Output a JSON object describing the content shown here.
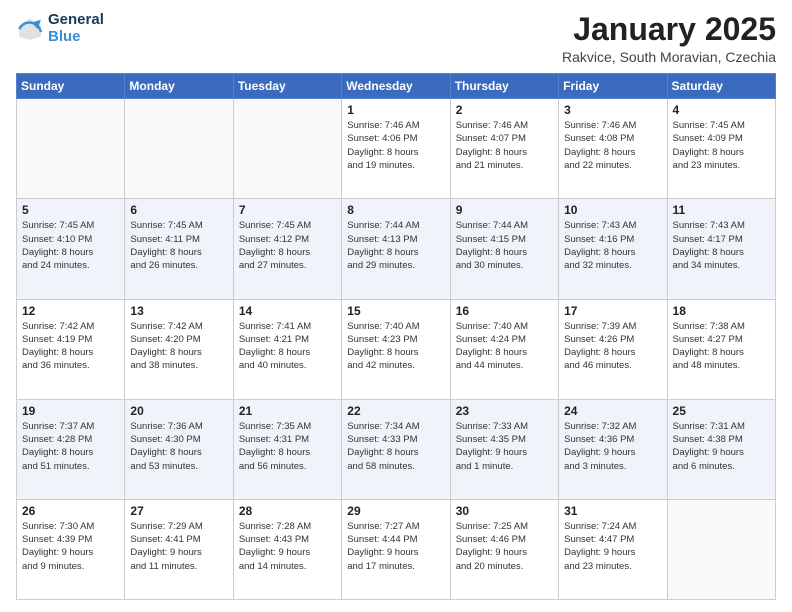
{
  "logo": {
    "line1": "General",
    "line2": "Blue"
  },
  "title": "January 2025",
  "location": "Rakvice, South Moravian, Czechia",
  "days_header": [
    "Sunday",
    "Monday",
    "Tuesday",
    "Wednesday",
    "Thursday",
    "Friday",
    "Saturday"
  ],
  "weeks": [
    [
      {
        "day": "",
        "info": ""
      },
      {
        "day": "",
        "info": ""
      },
      {
        "day": "",
        "info": ""
      },
      {
        "day": "1",
        "info": "Sunrise: 7:46 AM\nSunset: 4:06 PM\nDaylight: 8 hours\nand 19 minutes."
      },
      {
        "day": "2",
        "info": "Sunrise: 7:46 AM\nSunset: 4:07 PM\nDaylight: 8 hours\nand 21 minutes."
      },
      {
        "day": "3",
        "info": "Sunrise: 7:46 AM\nSunset: 4:08 PM\nDaylight: 8 hours\nand 22 minutes."
      },
      {
        "day": "4",
        "info": "Sunrise: 7:45 AM\nSunset: 4:09 PM\nDaylight: 8 hours\nand 23 minutes."
      }
    ],
    [
      {
        "day": "5",
        "info": "Sunrise: 7:45 AM\nSunset: 4:10 PM\nDaylight: 8 hours\nand 24 minutes."
      },
      {
        "day": "6",
        "info": "Sunrise: 7:45 AM\nSunset: 4:11 PM\nDaylight: 8 hours\nand 26 minutes."
      },
      {
        "day": "7",
        "info": "Sunrise: 7:45 AM\nSunset: 4:12 PM\nDaylight: 8 hours\nand 27 minutes."
      },
      {
        "day": "8",
        "info": "Sunrise: 7:44 AM\nSunset: 4:13 PM\nDaylight: 8 hours\nand 29 minutes."
      },
      {
        "day": "9",
        "info": "Sunrise: 7:44 AM\nSunset: 4:15 PM\nDaylight: 8 hours\nand 30 minutes."
      },
      {
        "day": "10",
        "info": "Sunrise: 7:43 AM\nSunset: 4:16 PM\nDaylight: 8 hours\nand 32 minutes."
      },
      {
        "day": "11",
        "info": "Sunrise: 7:43 AM\nSunset: 4:17 PM\nDaylight: 8 hours\nand 34 minutes."
      }
    ],
    [
      {
        "day": "12",
        "info": "Sunrise: 7:42 AM\nSunset: 4:19 PM\nDaylight: 8 hours\nand 36 minutes."
      },
      {
        "day": "13",
        "info": "Sunrise: 7:42 AM\nSunset: 4:20 PM\nDaylight: 8 hours\nand 38 minutes."
      },
      {
        "day": "14",
        "info": "Sunrise: 7:41 AM\nSunset: 4:21 PM\nDaylight: 8 hours\nand 40 minutes."
      },
      {
        "day": "15",
        "info": "Sunrise: 7:40 AM\nSunset: 4:23 PM\nDaylight: 8 hours\nand 42 minutes."
      },
      {
        "day": "16",
        "info": "Sunrise: 7:40 AM\nSunset: 4:24 PM\nDaylight: 8 hours\nand 44 minutes."
      },
      {
        "day": "17",
        "info": "Sunrise: 7:39 AM\nSunset: 4:26 PM\nDaylight: 8 hours\nand 46 minutes."
      },
      {
        "day": "18",
        "info": "Sunrise: 7:38 AM\nSunset: 4:27 PM\nDaylight: 8 hours\nand 48 minutes."
      }
    ],
    [
      {
        "day": "19",
        "info": "Sunrise: 7:37 AM\nSunset: 4:28 PM\nDaylight: 8 hours\nand 51 minutes."
      },
      {
        "day": "20",
        "info": "Sunrise: 7:36 AM\nSunset: 4:30 PM\nDaylight: 8 hours\nand 53 minutes."
      },
      {
        "day": "21",
        "info": "Sunrise: 7:35 AM\nSunset: 4:31 PM\nDaylight: 8 hours\nand 56 minutes."
      },
      {
        "day": "22",
        "info": "Sunrise: 7:34 AM\nSunset: 4:33 PM\nDaylight: 8 hours\nand 58 minutes."
      },
      {
        "day": "23",
        "info": "Sunrise: 7:33 AM\nSunset: 4:35 PM\nDaylight: 9 hours\nand 1 minute."
      },
      {
        "day": "24",
        "info": "Sunrise: 7:32 AM\nSunset: 4:36 PM\nDaylight: 9 hours\nand 3 minutes."
      },
      {
        "day": "25",
        "info": "Sunrise: 7:31 AM\nSunset: 4:38 PM\nDaylight: 9 hours\nand 6 minutes."
      }
    ],
    [
      {
        "day": "26",
        "info": "Sunrise: 7:30 AM\nSunset: 4:39 PM\nDaylight: 9 hours\nand 9 minutes."
      },
      {
        "day": "27",
        "info": "Sunrise: 7:29 AM\nSunset: 4:41 PM\nDaylight: 9 hours\nand 11 minutes."
      },
      {
        "day": "28",
        "info": "Sunrise: 7:28 AM\nSunset: 4:43 PM\nDaylight: 9 hours\nand 14 minutes."
      },
      {
        "day": "29",
        "info": "Sunrise: 7:27 AM\nSunset: 4:44 PM\nDaylight: 9 hours\nand 17 minutes."
      },
      {
        "day": "30",
        "info": "Sunrise: 7:25 AM\nSunset: 4:46 PM\nDaylight: 9 hours\nand 20 minutes."
      },
      {
        "day": "31",
        "info": "Sunrise: 7:24 AM\nSunset: 4:47 PM\nDaylight: 9 hours\nand 23 minutes."
      },
      {
        "day": "",
        "info": ""
      }
    ]
  ]
}
